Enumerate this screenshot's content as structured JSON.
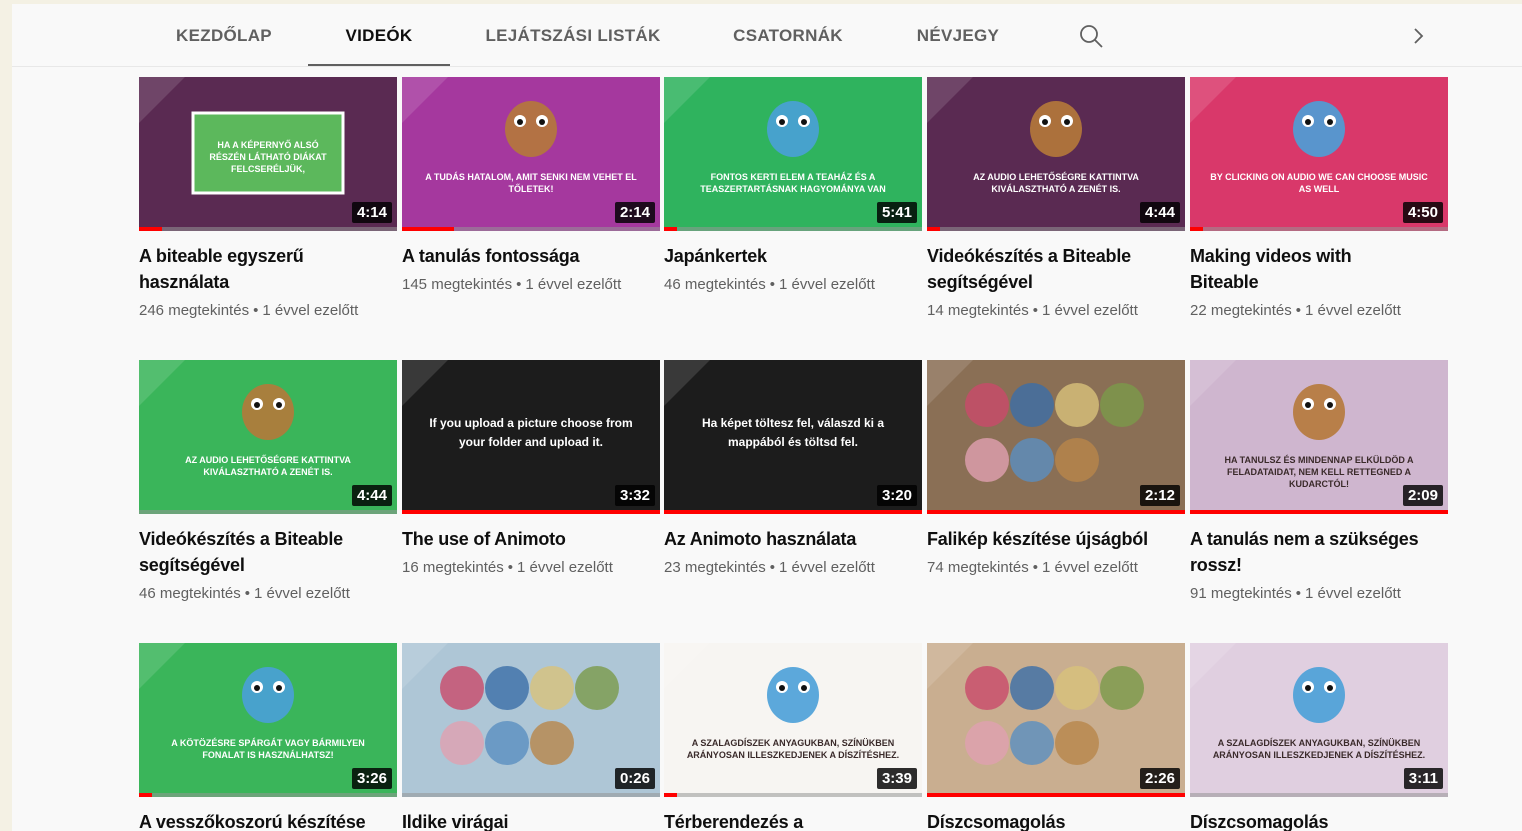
{
  "tabs": [
    {
      "label": "KEZDŐLAP",
      "active": false
    },
    {
      "label": "VIDEÓK",
      "active": true
    },
    {
      "label": "LEJÁTSZÁSI LISTÁK",
      "active": false
    },
    {
      "label": "CSATORNÁK",
      "active": false
    },
    {
      "label": "NÉVJEGY",
      "active": false
    }
  ],
  "icons": {
    "search": "search-icon",
    "next": "chevron-right-icon"
  },
  "videos": [
    {
      "title": "A biteable egyszerű használata",
      "views": "246 megtekintés",
      "age": "1 évvel ezelőtt",
      "duration": "4:14",
      "progress": 0.09,
      "bg": "#5a2a52",
      "thumb_text": "HA A KÉPERNYŐ ALSÓ RÉSZÉN LÁTHATÓ DIÁKAT FELCSERÉLJÜK,"
    },
    {
      "title": "A tanulás fontossága",
      "views": "145 megtekintés",
      "age": "1 évvel ezelőtt",
      "duration": "2:14",
      "progress": 0.2,
      "bg": "#a5389e",
      "thumb_text": "A TUDÁS HATALOM, AMIT SENKI NEM VEHET EL TŐLETEK!"
    },
    {
      "title": "Japánkertek",
      "views": "46 megtekintés",
      "age": "1 évvel ezelőtt",
      "duration": "5:41",
      "progress": 0.05,
      "bg": "#2fb35e",
      "thumb_text": "FONTOS KERTI ELEM A TEAHÁZ ÉS A TEASZERTARTÁSNAK HAGYOMÁNYA VAN"
    },
    {
      "title": "Videókészítés a Biteable segítségével",
      "views": "14 megtekintés",
      "age": "1 évvel ezelőtt",
      "duration": "4:44",
      "progress": 0.05,
      "bg": "#5a2a52",
      "thumb_text": "AZ AUDIO LEHETŐSÉGRE KATTINTVA KIVÁLASZTHATÓ A ZENÉT IS."
    },
    {
      "title": "Making videos with Biteable",
      "views": "22 megtekintés",
      "age": "1 évvel ezelőtt",
      "duration": "4:50",
      "progress": 0.05,
      "bg": "#d9386a",
      "thumb_text": "BY CLICKING ON AUDIO WE CAN CHOOSE MUSIC AS WELL"
    },
    {
      "title": "Videókészítés a Biteable segítségével",
      "views": "46 megtekintés",
      "age": "1 évvel ezelőtt",
      "duration": "4:44",
      "progress": 0.0,
      "bg": "#3ab55a",
      "thumb_text": "AZ AUDIO LEHETŐSÉGRE KATTINTVA KIVÁLASZTHATÓ A ZENÉT IS."
    },
    {
      "title": "The use of Animoto",
      "views": "16 megtekintés",
      "age": "1 évvel ezelőtt",
      "duration": "3:32",
      "progress": 1.0,
      "bg": "#1c1c1c",
      "thumb_text": "If you upload a picture choose from your folder and upload it."
    },
    {
      "title": "Az Animoto használata",
      "views": "23 megtekintés",
      "age": "1 évvel ezelőtt",
      "duration": "3:20",
      "progress": 1.0,
      "bg": "#1c1c1c",
      "thumb_text": "Ha képet töltesz fel, válaszd ki a mappából és töltsd fel."
    },
    {
      "title": "Falikép készítése újságból",
      "views": "74 megtekintés",
      "age": "1 évvel ezelőtt",
      "duration": "2:12",
      "progress": 1.0,
      "bg": "#8a6f55",
      "thumb_text": ""
    },
    {
      "title": "A tanulás nem a szükséges rossz!",
      "views": "91 megtekintés",
      "age": "1 évvel ezelőtt",
      "duration": "2:09",
      "progress": 1.0,
      "bg": "#cfb6cf",
      "thumb_text": "HA TANULSZ ÉS MINDENNAP ELKÜLDÖD A FELADATAIDAT, NEM KELL RETTEGNED A KUDARCTÓL!"
    },
    {
      "title": "A vesszőkoszorú készítése",
      "views": "",
      "age": "",
      "duration": "3:26",
      "progress": 0.05,
      "bg": "#3ab55a",
      "thumb_text": "A KÖTÖZÉSRE SPÁRGÁT VAGY BÁRMILYEN FONALAT IS HASZNÁLHATSZ!"
    },
    {
      "title": "Ildike virágai",
      "views": "",
      "age": "",
      "duration": "0:26",
      "progress": 0.0,
      "bg": "#aec6d6",
      "thumb_text": ""
    },
    {
      "title": "Térberendezés a",
      "views": "",
      "age": "",
      "duration": "3:39",
      "progress": 0.05,
      "bg": "#f7f5f2",
      "thumb_text": "A SZALAGDÍSZEK ANYAGUKBAN, SZÍNÜKBEN ARÁNYOSAN ILLESZKEDJENEK A DÍSZÍTÉSHEZ."
    },
    {
      "title": "Díszcsomagolás",
      "views": "",
      "age": "",
      "duration": "2:26",
      "progress": 1.0,
      "bg": "#c9ae90",
      "thumb_text": ""
    },
    {
      "title": "Díszcsomagolás",
      "views": "",
      "age": "",
      "duration": "3:11",
      "progress": 0.0,
      "bg": "#e0cfe0",
      "thumb_text": "A SZALAGDÍSZEK ANYAGUKBAN, SZÍNÜKBEN ARÁNYOSAN ILLESZKEDJENEK A DÍSZÍTÉSHEZ."
    }
  ]
}
